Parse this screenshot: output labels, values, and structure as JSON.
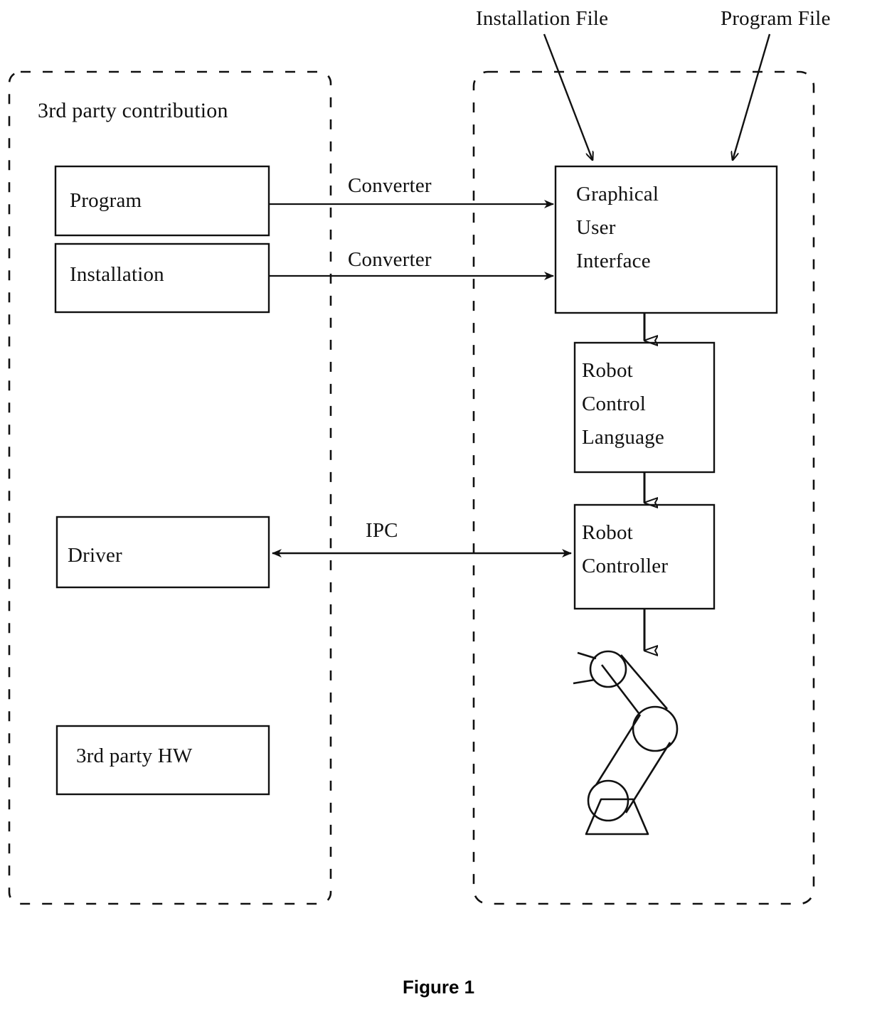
{
  "figure": {
    "caption": "Figure 1"
  },
  "annotations": {
    "installation_file": "Installation File",
    "program_file": "Program File"
  },
  "groups": {
    "third_party": {
      "title": "3rd party contribution"
    },
    "robot_system": {
      "title": ""
    }
  },
  "blocks": {
    "program": "Program",
    "installation": "Installation",
    "driver": "Driver",
    "third_party_hw": "3rd party HW",
    "gui_line1": "Graphical",
    "gui_line2": "User",
    "gui_line3": "Interface",
    "rcl_line1": "Robot",
    "rcl_line2": "Control",
    "rcl_line3": "Language",
    "controller_line1": "Robot",
    "controller_line2": "Controller"
  },
  "edges": {
    "converter_program": "Converter",
    "converter_installation": "Converter",
    "ipc": "IPC"
  },
  "colors": {
    "stroke": "#111111",
    "background": "#ffffff"
  }
}
